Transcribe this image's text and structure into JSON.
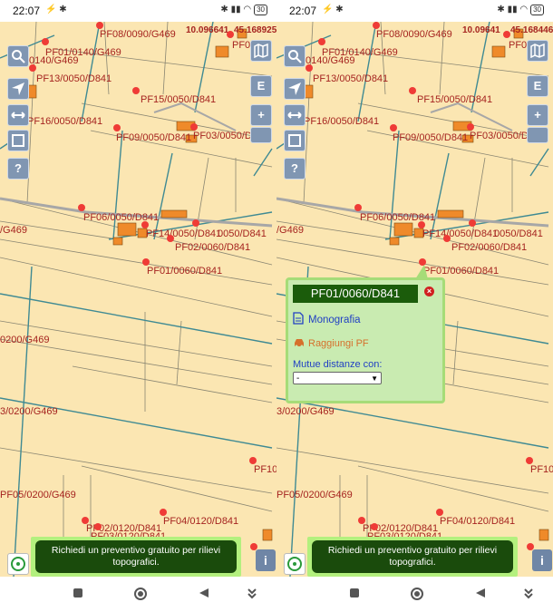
{
  "status": {
    "time": "22:07",
    "battery": "30"
  },
  "parcels": {
    "pf08": "PF08/0090/G469",
    "pf01_0140": "PF01/0140/G469",
    "g469_0140": "0140/G469",
    "pf13": "PF13/0050/D841",
    "pf15": "PF15/0050/D841",
    "pf16": "PF16/0050/D841",
    "pf09": "PF09/0050/D841",
    "pf03": "PF03/0050/D841",
    "pf06": "PF06/0050/D841",
    "g469_left": "/G469",
    "pf14": "PF14/0050/D841",
    "pf0050": "0050/D841",
    "pf02": "PF02/0060/D841",
    "pf01_0060": "PF01/0060/D841",
    "g0200": "0200/G469",
    "g3_0200": "3/0200/G469",
    "pf05_0200": "PF05/0200/G469",
    "pf04_0120": "PF04/0120/D841",
    "pf02_0120": "PF02/0120/D841",
    "pf03_0120": "PF03/0120/D841",
    "pf10": "PF10",
    "coords_left": "10.096641",
    "coords_right": "45.168925",
    "coords2_left": "10.09641",
    "coords2_right": "45.168446",
    "pf0": "PF0"
  },
  "toolbar": {
    "help": "?",
    "e_button": "E",
    "plus": "+"
  },
  "banner": {
    "text": "Richiedi un preventivo gratuito per rilievi topografici."
  },
  "info_button": "i",
  "popup": {
    "title": "PF01/0060/D841",
    "monografia": "Monografia",
    "raggiungi": "Raggiungi PF",
    "mutue": "Mutue distanze con:",
    "select_value": "-"
  },
  "icons": {
    "search": "search-icon",
    "map": "map-icon",
    "navigate": "navigate-icon",
    "expand": "expand-icon",
    "layers": "square-icon",
    "location": "location-icon"
  },
  "colors": {
    "map_bg": "#fbe6b2",
    "parcel_label": "#a5231f",
    "point": "#ef3b36",
    "popup_bg": "#c9ebb1",
    "popup_title": "#1b5c0b",
    "banner": "#1a4b0c"
  }
}
